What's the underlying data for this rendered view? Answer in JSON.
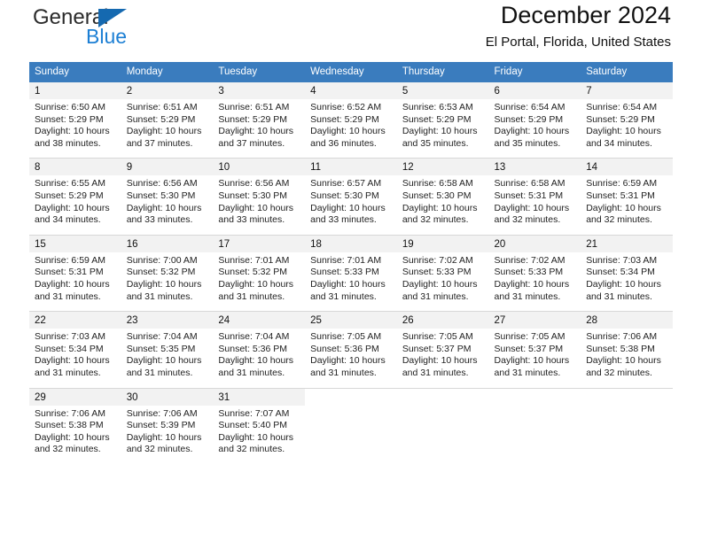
{
  "brand": {
    "name_part1": "General",
    "name_part2": "Blue",
    "triangle_color": "#1569b0",
    "blue_color": "#1c7fd4"
  },
  "header": {
    "title": "December 2024",
    "subtitle": "El Portal, Florida, United States",
    "header_bg": "#3a7cbe",
    "daynum_bg": "#f2f2f2"
  },
  "weekdays": [
    "Sunday",
    "Monday",
    "Tuesday",
    "Wednesday",
    "Thursday",
    "Friday",
    "Saturday"
  ],
  "weeks": [
    [
      {
        "day": "1",
        "sunrise": "Sunrise: 6:50 AM",
        "sunset": "Sunset: 5:29 PM",
        "daylight1": "Daylight: 10 hours",
        "daylight2": "and 38 minutes."
      },
      {
        "day": "2",
        "sunrise": "Sunrise: 6:51 AM",
        "sunset": "Sunset: 5:29 PM",
        "daylight1": "Daylight: 10 hours",
        "daylight2": "and 37 minutes."
      },
      {
        "day": "3",
        "sunrise": "Sunrise: 6:51 AM",
        "sunset": "Sunset: 5:29 PM",
        "daylight1": "Daylight: 10 hours",
        "daylight2": "and 37 minutes."
      },
      {
        "day": "4",
        "sunrise": "Sunrise: 6:52 AM",
        "sunset": "Sunset: 5:29 PM",
        "daylight1": "Daylight: 10 hours",
        "daylight2": "and 36 minutes."
      },
      {
        "day": "5",
        "sunrise": "Sunrise: 6:53 AM",
        "sunset": "Sunset: 5:29 PM",
        "daylight1": "Daylight: 10 hours",
        "daylight2": "and 35 minutes."
      },
      {
        "day": "6",
        "sunrise": "Sunrise: 6:54 AM",
        "sunset": "Sunset: 5:29 PM",
        "daylight1": "Daylight: 10 hours",
        "daylight2": "and 35 minutes."
      },
      {
        "day": "7",
        "sunrise": "Sunrise: 6:54 AM",
        "sunset": "Sunset: 5:29 PM",
        "daylight1": "Daylight: 10 hours",
        "daylight2": "and 34 minutes."
      }
    ],
    [
      {
        "day": "8",
        "sunrise": "Sunrise: 6:55 AM",
        "sunset": "Sunset: 5:29 PM",
        "daylight1": "Daylight: 10 hours",
        "daylight2": "and 34 minutes."
      },
      {
        "day": "9",
        "sunrise": "Sunrise: 6:56 AM",
        "sunset": "Sunset: 5:30 PM",
        "daylight1": "Daylight: 10 hours",
        "daylight2": "and 33 minutes."
      },
      {
        "day": "10",
        "sunrise": "Sunrise: 6:56 AM",
        "sunset": "Sunset: 5:30 PM",
        "daylight1": "Daylight: 10 hours",
        "daylight2": "and 33 minutes."
      },
      {
        "day": "11",
        "sunrise": "Sunrise: 6:57 AM",
        "sunset": "Sunset: 5:30 PM",
        "daylight1": "Daylight: 10 hours",
        "daylight2": "and 33 minutes."
      },
      {
        "day": "12",
        "sunrise": "Sunrise: 6:58 AM",
        "sunset": "Sunset: 5:30 PM",
        "daylight1": "Daylight: 10 hours",
        "daylight2": "and 32 minutes."
      },
      {
        "day": "13",
        "sunrise": "Sunrise: 6:58 AM",
        "sunset": "Sunset: 5:31 PM",
        "daylight1": "Daylight: 10 hours",
        "daylight2": "and 32 minutes."
      },
      {
        "day": "14",
        "sunrise": "Sunrise: 6:59 AM",
        "sunset": "Sunset: 5:31 PM",
        "daylight1": "Daylight: 10 hours",
        "daylight2": "and 32 minutes."
      }
    ],
    [
      {
        "day": "15",
        "sunrise": "Sunrise: 6:59 AM",
        "sunset": "Sunset: 5:31 PM",
        "daylight1": "Daylight: 10 hours",
        "daylight2": "and 31 minutes."
      },
      {
        "day": "16",
        "sunrise": "Sunrise: 7:00 AM",
        "sunset": "Sunset: 5:32 PM",
        "daylight1": "Daylight: 10 hours",
        "daylight2": "and 31 minutes."
      },
      {
        "day": "17",
        "sunrise": "Sunrise: 7:01 AM",
        "sunset": "Sunset: 5:32 PM",
        "daylight1": "Daylight: 10 hours",
        "daylight2": "and 31 minutes."
      },
      {
        "day": "18",
        "sunrise": "Sunrise: 7:01 AM",
        "sunset": "Sunset: 5:33 PM",
        "daylight1": "Daylight: 10 hours",
        "daylight2": "and 31 minutes."
      },
      {
        "day": "19",
        "sunrise": "Sunrise: 7:02 AM",
        "sunset": "Sunset: 5:33 PM",
        "daylight1": "Daylight: 10 hours",
        "daylight2": "and 31 minutes."
      },
      {
        "day": "20",
        "sunrise": "Sunrise: 7:02 AM",
        "sunset": "Sunset: 5:33 PM",
        "daylight1": "Daylight: 10 hours",
        "daylight2": "and 31 minutes."
      },
      {
        "day": "21",
        "sunrise": "Sunrise: 7:03 AM",
        "sunset": "Sunset: 5:34 PM",
        "daylight1": "Daylight: 10 hours",
        "daylight2": "and 31 minutes."
      }
    ],
    [
      {
        "day": "22",
        "sunrise": "Sunrise: 7:03 AM",
        "sunset": "Sunset: 5:34 PM",
        "daylight1": "Daylight: 10 hours",
        "daylight2": "and 31 minutes."
      },
      {
        "day": "23",
        "sunrise": "Sunrise: 7:04 AM",
        "sunset": "Sunset: 5:35 PM",
        "daylight1": "Daylight: 10 hours",
        "daylight2": "and 31 minutes."
      },
      {
        "day": "24",
        "sunrise": "Sunrise: 7:04 AM",
        "sunset": "Sunset: 5:36 PM",
        "daylight1": "Daylight: 10 hours",
        "daylight2": "and 31 minutes."
      },
      {
        "day": "25",
        "sunrise": "Sunrise: 7:05 AM",
        "sunset": "Sunset: 5:36 PM",
        "daylight1": "Daylight: 10 hours",
        "daylight2": "and 31 minutes."
      },
      {
        "day": "26",
        "sunrise": "Sunrise: 7:05 AM",
        "sunset": "Sunset: 5:37 PM",
        "daylight1": "Daylight: 10 hours",
        "daylight2": "and 31 minutes."
      },
      {
        "day": "27",
        "sunrise": "Sunrise: 7:05 AM",
        "sunset": "Sunset: 5:37 PM",
        "daylight1": "Daylight: 10 hours",
        "daylight2": "and 31 minutes."
      },
      {
        "day": "28",
        "sunrise": "Sunrise: 7:06 AM",
        "sunset": "Sunset: 5:38 PM",
        "daylight1": "Daylight: 10 hours",
        "daylight2": "and 32 minutes."
      }
    ],
    [
      {
        "day": "29",
        "sunrise": "Sunrise: 7:06 AM",
        "sunset": "Sunset: 5:38 PM",
        "daylight1": "Daylight: 10 hours",
        "daylight2": "and 32 minutes."
      },
      {
        "day": "30",
        "sunrise": "Sunrise: 7:06 AM",
        "sunset": "Sunset: 5:39 PM",
        "daylight1": "Daylight: 10 hours",
        "daylight2": "and 32 minutes."
      },
      {
        "day": "31",
        "sunrise": "Sunrise: 7:07 AM",
        "sunset": "Sunset: 5:40 PM",
        "daylight1": "Daylight: 10 hours",
        "daylight2": "and 32 minutes."
      },
      {
        "day": "",
        "sunrise": "",
        "sunset": "",
        "daylight1": "",
        "daylight2": ""
      },
      {
        "day": "",
        "sunrise": "",
        "sunset": "",
        "daylight1": "",
        "daylight2": ""
      },
      {
        "day": "",
        "sunrise": "",
        "sunset": "",
        "daylight1": "",
        "daylight2": ""
      },
      {
        "day": "",
        "sunrise": "",
        "sunset": "",
        "daylight1": "",
        "daylight2": ""
      }
    ]
  ]
}
